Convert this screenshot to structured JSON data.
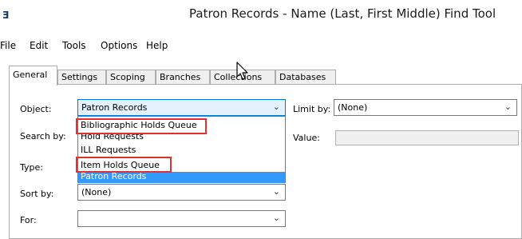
{
  "window": {
    "title": "Patron Records - Name (Last, First Middle) Find Tool"
  },
  "menu": [
    "File",
    "Edit",
    "Tools",
    "Options",
    "Help"
  ],
  "tabs": [
    {
      "label": "General",
      "active": true
    },
    {
      "label": "Settings",
      "active": false
    },
    {
      "label": "Scoping",
      "active": false
    },
    {
      "label": "Branches",
      "active": false
    },
    {
      "label": "Collections",
      "active": false
    },
    {
      "label": "Databases",
      "active": false
    }
  ],
  "form": {
    "object_label": "Object:",
    "object_value": "Patron Records",
    "search_by_label": "Search by:",
    "type_label": "Type:",
    "sort_by_label": "Sort by:",
    "sort_by_value": "(None)",
    "for_label": "For:",
    "for_value": "",
    "limit_by_label": "Limit by:",
    "limit_by_value": "(None)",
    "value_label": "Value:",
    "value_value": ""
  },
  "object_dropdown": {
    "options": [
      {
        "label": "Bibliographic Holds Queue",
        "highlighted": true
      },
      {
        "label": "Hold Requests",
        "highlighted": false
      },
      {
        "label": "ILL Requests",
        "highlighted": false
      },
      {
        "label": "Item Holds Queue",
        "highlighted": true
      },
      {
        "label": "Patron Records",
        "selected": true
      }
    ]
  },
  "colors": {
    "highlight_box": "#e03030",
    "selection": "#3399ff",
    "focus_bg": "#e5f1fb"
  }
}
